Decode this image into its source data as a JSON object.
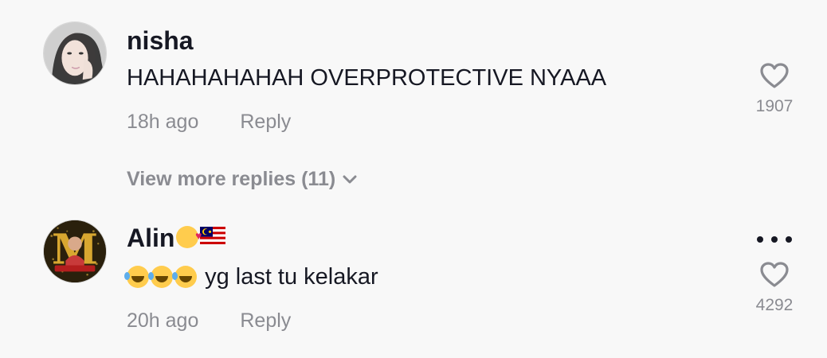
{
  "comments": [
    {
      "username": "nisha",
      "text": "HAHAHAHAHAH OVERPROTECTIVE NYAAA",
      "time": "18h ago",
      "reply_label": "Reply",
      "like_count": "1907",
      "like_icon": "heart-outline-icon"
    },
    {
      "username": "Alin",
      "username_emojis": [
        "smiling-face-with-hearts-emoji",
        "malaysia-flag-emoji"
      ],
      "text_emojis": [
        "rolling-on-floor-laughing-emoji",
        "rolling-on-floor-laughing-emoji",
        "rolling-on-floor-laughing-emoji"
      ],
      "text": "yg last tu kelakar",
      "time": "20h ago",
      "reply_label": "Reply",
      "like_count": "4292",
      "like_icon": "heart-outline-icon",
      "more_icon": "more-options-icon"
    }
  ],
  "view_more": {
    "label": "View more replies (11)",
    "icon": "chevron-down-icon"
  },
  "colors": {
    "background": "#f8f8f8",
    "primary_text": "#161823",
    "secondary_text": "#8a8b91"
  }
}
